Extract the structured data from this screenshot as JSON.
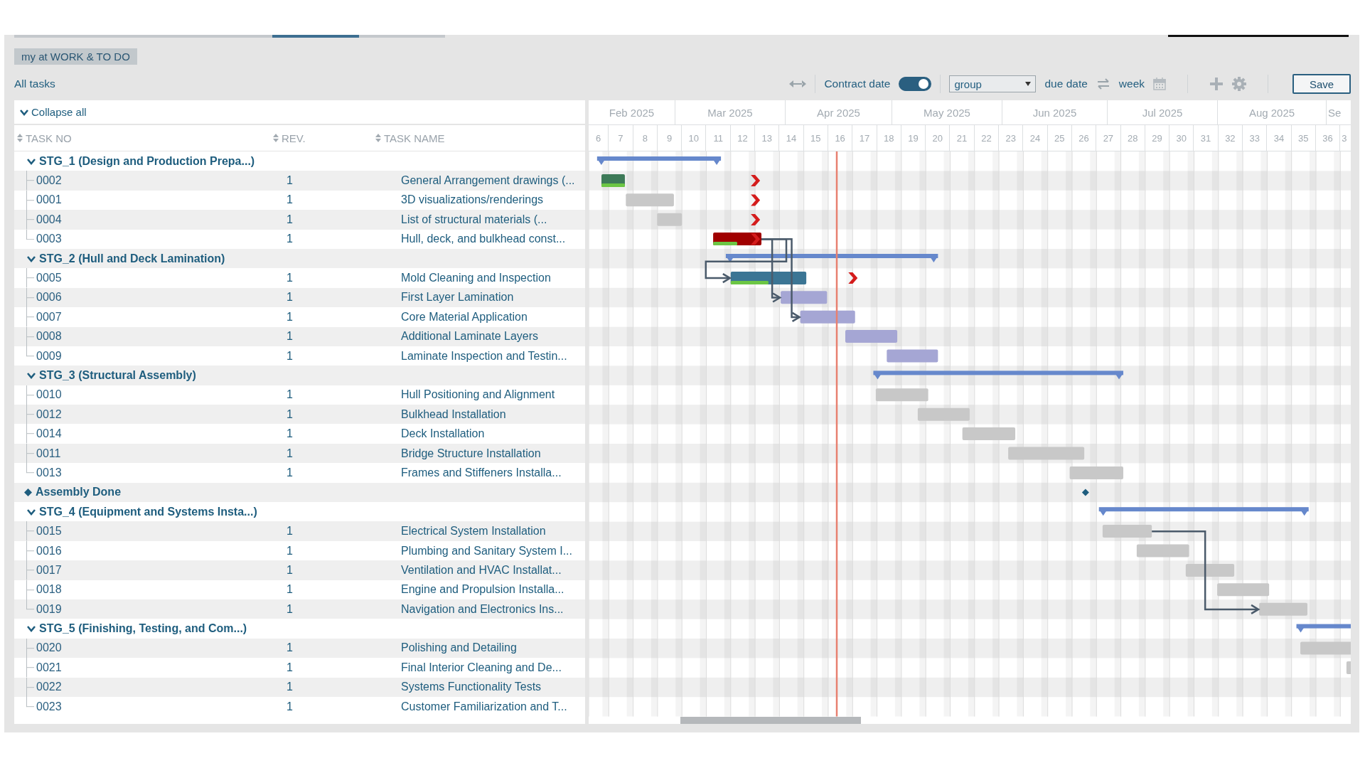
{
  "top_tabs": [
    {
      "selected": false
    },
    {
      "selected": true
    },
    {
      "selected": false
    }
  ],
  "view_chip": "my at WORK & TO DO",
  "list_title": "All tasks",
  "toolbar": {
    "contract_date_label": "Contract date",
    "contract_date_on": true,
    "group_select": "group",
    "due_date_label": "due date",
    "scale_label": "week",
    "save_label": "Save"
  },
  "collapse_all": "Collapse all",
  "columns": [
    "TASK NO",
    "REV.",
    "TASK NAME"
  ],
  "months": [
    "Feb 2025",
    "Mar 2025",
    "Apr 2025",
    "May 2025",
    "Jun 2025",
    "Jul 2025",
    "Aug 2025",
    "Se"
  ],
  "weeks": [
    "6",
    "7",
    "8",
    "9",
    "10",
    "11",
    "12",
    "13",
    "14",
    "15",
    "16",
    "17",
    "18",
    "19",
    "20",
    "21",
    "22",
    "23",
    "24",
    "25",
    "26",
    "27",
    "28",
    "29",
    "30",
    "31",
    "32",
    "33",
    "34",
    "35",
    "36",
    "3"
  ],
  "tasks": [
    {
      "kind": "group",
      "name": "STG_1 (Design and Production Prepa...)",
      "expanded": true,
      "children": [
        {
          "kind": "task",
          "task_no": "0002",
          "rev": "1",
          "name": "General Arrangement drawings (...",
          "color": "#3d7a58",
          "level": 1,
          "due_marker": true
        },
        {
          "kind": "task",
          "task_no": "0001",
          "rev": "1",
          "name": "3D visualizations/renderings",
          "color": "#c8c8c8",
          "due_marker": true
        },
        {
          "kind": "task",
          "task_no": "0004",
          "rev": "1",
          "name": "List of structural materials (...",
          "color": "#c8c8c8",
          "due_marker": true
        },
        {
          "kind": "task",
          "task_no": "0003",
          "rev": "1",
          "name": "Hull, deck, and bulkhead const...",
          "color": "#a00000",
          "level": 0.5,
          "due_marker": true
        }
      ]
    },
    {
      "kind": "group",
      "name": "STG_2 (Hull and Deck Lamination)",
      "expanded": true,
      "children": [
        {
          "kind": "task",
          "task_no": "0005",
          "rev": "1",
          "name": "Mold Cleaning and Inspection",
          "color": "#3b7594",
          "level": 0.5,
          "due_marker": true
        },
        {
          "kind": "task",
          "task_no": "0006",
          "rev": "1",
          "name": "First Layer Lamination",
          "color": "#a5a6d4",
          "due_marker": false
        },
        {
          "kind": "task",
          "task_no": "0007",
          "rev": "1",
          "name": "Core Material Application",
          "color": "#a5a6d4",
          "due_marker": false
        },
        {
          "kind": "task",
          "task_no": "0008",
          "rev": "1",
          "name": "Additional Laminate Layers",
          "color": "#a5a6d4",
          "due_marker": false
        },
        {
          "kind": "task",
          "task_no": "0009",
          "rev": "1",
          "name": "Laminate Inspection and Testin...",
          "color": "#a5a6d4",
          "due_marker": false
        }
      ]
    },
    {
      "kind": "group",
      "name": "STG_3 (Structural Assembly)",
      "expanded": true,
      "children": [
        {
          "kind": "task",
          "task_no": "0010",
          "rev": "1",
          "name": "Hull Positioning and Alignment",
          "color": "#c8c8c8",
          "due_marker": false
        },
        {
          "kind": "task",
          "task_no": "0012",
          "rev": "1",
          "name": "Bulkhead Installation",
          "color": "#c8c8c8",
          "due_marker": false
        },
        {
          "kind": "task",
          "task_no": "0014",
          "rev": "1",
          "name": "Deck Installation",
          "color": "#c8c8c8",
          "due_marker": false
        },
        {
          "kind": "task",
          "task_no": "0011",
          "rev": "1",
          "name": "Bridge Structure Installation",
          "color": "#c8c8c8",
          "due_marker": false
        },
        {
          "kind": "task",
          "task_no": "0013",
          "rev": "1",
          "name": "Frames and Stiffeners Installa...",
          "color": "#c8c8c8",
          "due_marker": false
        }
      ]
    },
    {
      "kind": "milestone",
      "name": "Assembly Done"
    },
    {
      "kind": "group",
      "name": "STG_4 (Equipment and Systems Insta...)",
      "expanded": true,
      "children": [
        {
          "kind": "task",
          "task_no": "0015",
          "rev": "1",
          "name": "Electrical System Installation",
          "color": "#c8c8c8",
          "due_marker": false
        },
        {
          "kind": "task",
          "task_no": "0016",
          "rev": "1",
          "name": "Plumbing and Sanitary System I...",
          "color": "#c8c8c8",
          "due_marker": false
        },
        {
          "kind": "task",
          "task_no": "0017",
          "rev": "1",
          "name": "Ventilation and HVAC Installat...",
          "color": "#c8c8c8",
          "due_marker": false
        },
        {
          "kind": "task",
          "task_no": "0018",
          "rev": "1",
          "name": "Engine and Propulsion Installa...",
          "color": "#c8c8c8",
          "due_marker": false
        },
        {
          "kind": "task",
          "task_no": "0019",
          "rev": "1",
          "name": "Navigation and Electronics Ins...",
          "color": "#c8c8c8",
          "due_marker": false
        }
      ]
    },
    {
      "kind": "group",
      "name": "STG_5 (Finishing, Testing, and Com...)",
      "expanded": true,
      "children": [
        {
          "kind": "task",
          "task_no": "0020",
          "rev": "1",
          "name": "Polishing and Detailing",
          "color": "#c8c8c8",
          "due_marker": false
        },
        {
          "kind": "task",
          "task_no": "0021",
          "rev": "1",
          "name": "Final Interior Cleaning and De...",
          "color": "#c8c8c8",
          "due_marker": false
        },
        {
          "kind": "task",
          "task_no": "0022",
          "rev": "1",
          "name": "Systems Functionality Tests",
          "due_marker": false
        },
        {
          "kind": "task",
          "task_no": "0023",
          "rev": "1",
          "name": "Customer Familiarization and T...",
          "due_marker": false
        }
      ]
    }
  ]
}
